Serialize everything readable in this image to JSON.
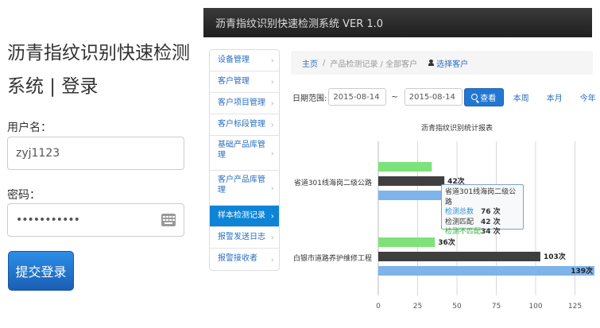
{
  "login": {
    "title": "沥青指纹识别快速检测系统 | 登录",
    "username_label": "用户名：",
    "username_value": "zyj1123",
    "password_label": "密码：",
    "password_value": "•••••••••••",
    "submit_label": "提交登录"
  },
  "app": {
    "title": "沥青指纹识别快速检测系统 VER 1.0"
  },
  "sidebar": {
    "items": [
      {
        "label": "设备管理"
      },
      {
        "label": "客户管理"
      },
      {
        "label": "客户项目管理"
      },
      {
        "label": "客户标段管理"
      },
      {
        "label": "基础产品库管理"
      },
      {
        "label": "客户产品库管理"
      },
      {
        "label": "样本检测记录"
      },
      {
        "label": "报警发送日志"
      },
      {
        "label": "报警接收者"
      }
    ],
    "chevron": "›"
  },
  "breadcrumb": {
    "home": "主页",
    "sep": "/",
    "current": "产品检测记录 / 全部客户",
    "select_customer": "选择客户"
  },
  "filter": {
    "date_label": "日期范围:",
    "start_date": "2015-08-14",
    "tilde": "~",
    "end_date": "2015-08-14",
    "search_label": "查看",
    "this_week": "本周",
    "this_month": "本月",
    "this_year": "今年"
  },
  "colors": {
    "green": "#7ee27a",
    "dark": "#3f3f3f",
    "blue": "#7eb4ea",
    "active": "#0d84d6"
  },
  "chart_data": {
    "type": "bar",
    "orientation": "horizontal",
    "title": "沥青指纹识别统计报表",
    "categories": [
      "省道301线海岗二级公路",
      "白银市道路养护维修工程"
    ],
    "series": [
      {
        "name": "检测不匹配",
        "color": "#7ee27a",
        "values": [
          34,
          36
        ],
        "labels": [
          "",
          "36次"
        ]
      },
      {
        "name": "检测匹配",
        "color": "#3f3f3f",
        "values": [
          42,
          103
        ],
        "labels": [
          "42次",
          "103次"
        ]
      },
      {
        "name": "检测总数",
        "color": "#7eb4ea",
        "values": [
          76,
          139
        ],
        "labels": [
          "76次",
          "139次"
        ]
      }
    ],
    "xlim": [
      0,
      139
    ],
    "x_ticks": [
      0,
      25,
      50,
      75,
      100,
      125
    ],
    "grid": true
  },
  "tooltip": {
    "title": "省道301线海岗二级公路",
    "rows": [
      {
        "label": "检测总数",
        "value": "76 次",
        "color": "#2a8fd6"
      },
      {
        "label": "检测匹配",
        "value": "42 次",
        "color": "#333333"
      },
      {
        "label": "检测不匹配",
        "value": "34 次",
        "color": "#33b233"
      }
    ]
  }
}
